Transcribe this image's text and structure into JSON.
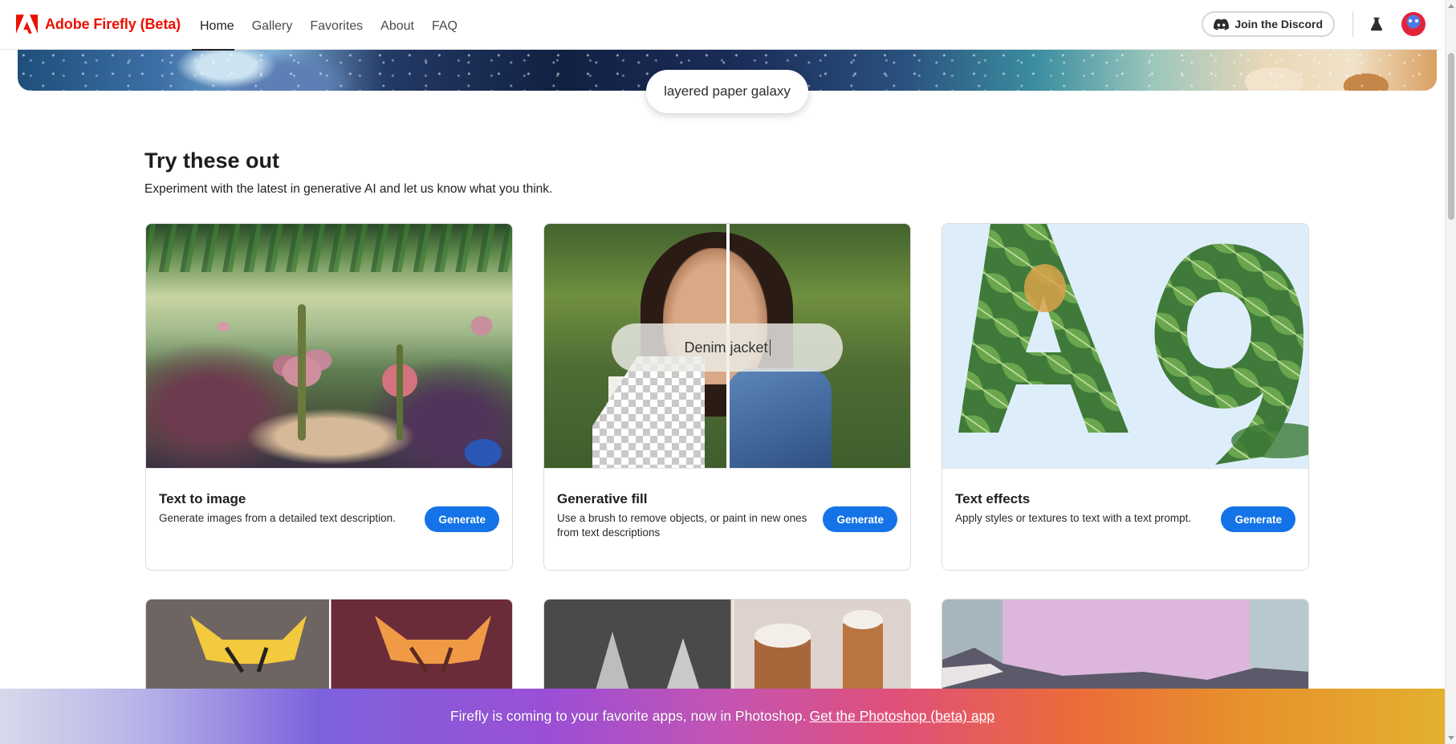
{
  "app": {
    "brand": "Adobe Firefly (Beta)",
    "brand_color": "#eb1000",
    "logo_icon": "adobe-logo-icon"
  },
  "nav": {
    "links": [
      {
        "label": "Home",
        "active": true
      },
      {
        "label": "Gallery",
        "active": false
      },
      {
        "label": "Favorites",
        "active": false
      },
      {
        "label": "About",
        "active": false
      },
      {
        "label": "FAQ",
        "active": false
      }
    ],
    "discord_label": "Join the Discord",
    "discord_icon": "discord-icon",
    "labs_icon": "beaker-icon",
    "avatar_icon": "user-avatar"
  },
  "hero": {
    "prompt_chip": "layered paper galaxy"
  },
  "section": {
    "title": "Try these out",
    "subtitle": "Experiment with the latest in generative AI and let us know what you think."
  },
  "cards": [
    {
      "title": "Text to image",
      "description": "Generate images from a detailed text description.",
      "button": "Generate"
    },
    {
      "title": "Generative fill",
      "description": "Use a brush to remove objects, or paint in new ones from text descriptions",
      "button": "Generate",
      "overlay_prompt": "Denim jacket"
    },
    {
      "title": "Text effects",
      "description": "Apply styles or textures to text with a text prompt.",
      "button": "Generate"
    }
  ],
  "promo": {
    "text": "Firefly is coming to your favorite apps, now in Photoshop.",
    "link": "Get the Photoshop (beta) app"
  },
  "colors": {
    "accent_button": "#1473e6"
  }
}
